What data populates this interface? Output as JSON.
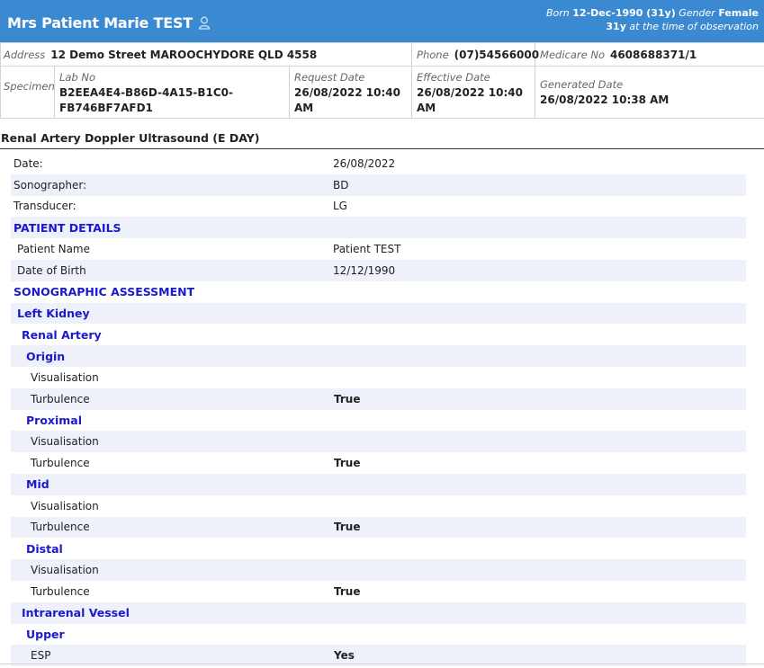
{
  "header": {
    "patient_name": "Mrs Patient Marie TEST",
    "born_label": "Born",
    "born_value": "12-Dec-1990 (31y)",
    "gender_label": "Gender",
    "gender_value": "Female",
    "age_value": "31y",
    "age_note": "at the time of observation",
    "bg_color": "#3b8ad1"
  },
  "info": {
    "address_label": "Address",
    "address_value": "12 Demo Street MAROOCHYDORE QLD 4558",
    "phone_label": "Phone",
    "phone_value": "(07)54566000",
    "medicare_label": "Medicare No",
    "medicare_value": "4608688371/1",
    "specimen_label": "Specimen",
    "labno_label": "Lab No",
    "labno_value_1": "B2EEA4E4-B86D-4A15-B1C0-",
    "labno_value_2": "FB746BF7AFD1",
    "request_label": "Request Date",
    "request_value_1": "26/08/2022 10:40",
    "request_value_2": "AM",
    "effective_label": "Effective Date",
    "effective_value_1": "26/08/2022 10:40",
    "effective_value_2": "AM",
    "generated_label": "Generated Date",
    "generated_value": "26/08/2022 10:38 AM"
  },
  "report": {
    "title": "Renal Artery Doppler Ultrasound (E DAY)",
    "rows": [
      {
        "key": "Date:",
        "value": "26/08/2022"
      },
      {
        "key": "Sonographer:",
        "value": "BD"
      },
      {
        "key": "Transducer:",
        "value": "LG"
      },
      {
        "key": "PATIENT DETAILS"
      },
      {
        "key": "Patient Name",
        "value": "Patient TEST"
      },
      {
        "key": "Date of Birth",
        "value": "12/12/1990"
      },
      {
        "key": "SONOGRAPHIC ASSESSMENT"
      },
      {
        "key": "Left Kidney"
      },
      {
        "key": "Renal Artery"
      },
      {
        "key": "Origin"
      },
      {
        "key": "Visualisation"
      },
      {
        "key": "Turbulence",
        "value": "True"
      },
      {
        "key": "Proximal"
      },
      {
        "key": "Visualisation"
      },
      {
        "key": "Turbulence",
        "value": "True"
      },
      {
        "key": "Mid"
      },
      {
        "key": "Visualisation"
      },
      {
        "key": "Turbulence",
        "value": "True"
      },
      {
        "key": "Distal"
      },
      {
        "key": "Visualisation"
      },
      {
        "key": "Turbulence",
        "value": "True"
      },
      {
        "key": "Intrarenal Vessel"
      },
      {
        "key": "Upper"
      },
      {
        "key": "ESP",
        "value": "Yes"
      }
    ]
  }
}
